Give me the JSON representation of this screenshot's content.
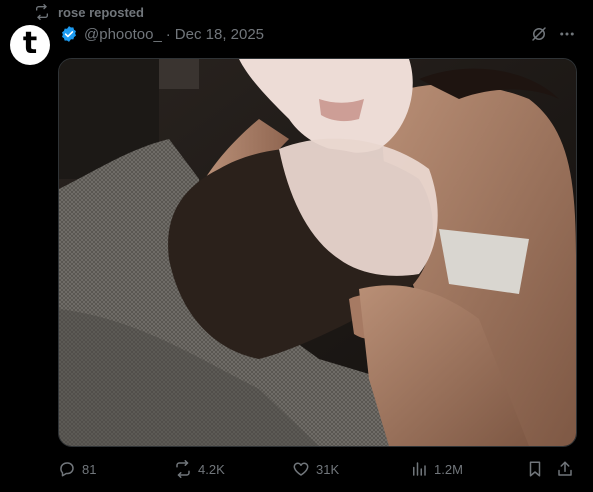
{
  "repost": {
    "label": "rose reposted"
  },
  "author": {
    "handle": "@phootoo_",
    "separator": "·",
    "date": "Dec 18, 2025",
    "avatar_letter": "t"
  },
  "media": {
    "alt": ""
  },
  "actions": {
    "replies": "81",
    "reposts": "4.2K",
    "likes": "31K",
    "views": "1.2M"
  },
  "colors": {
    "background": "#000000",
    "secondary": "#71767b",
    "verified": "#1d9bf0"
  }
}
